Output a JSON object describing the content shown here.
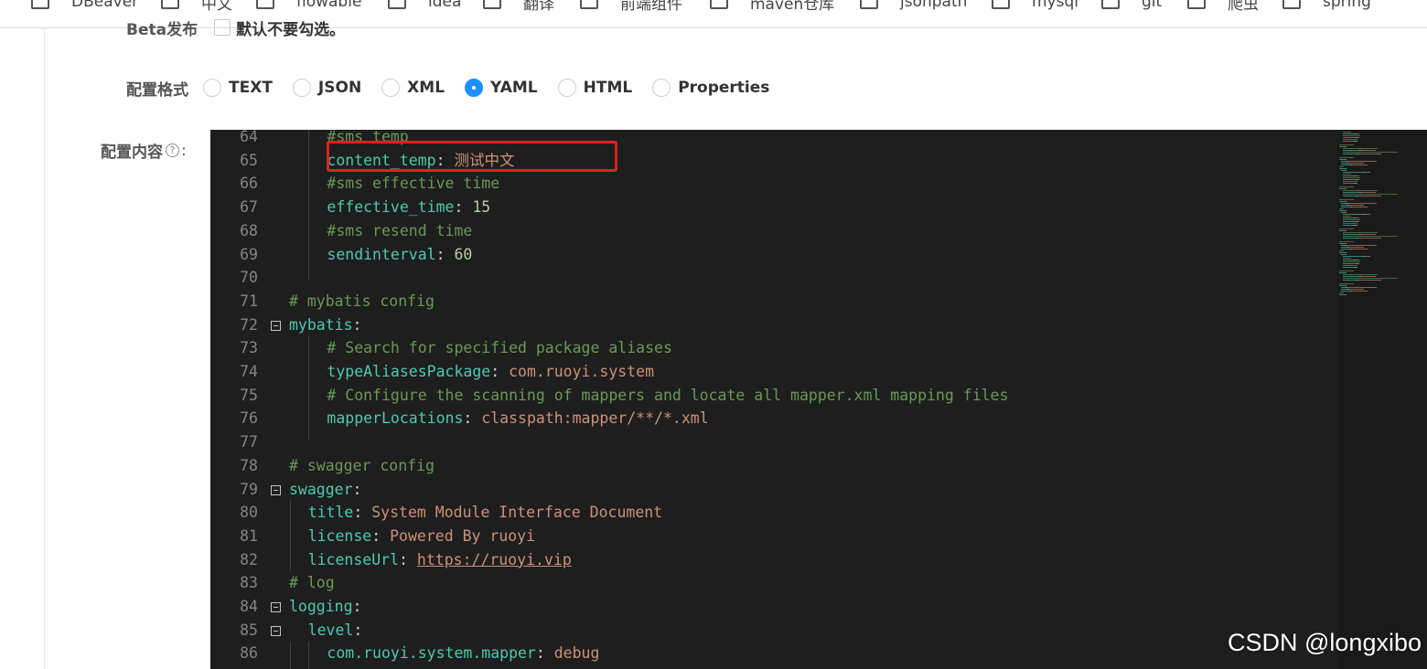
{
  "bookmarks": [
    "DBeaver",
    "中文",
    "flowable",
    "idea",
    "翻译",
    "前端组件",
    "maven仓库",
    "jsonpath",
    "mysql",
    "git",
    "爬虫",
    "spring"
  ],
  "beta": {
    "label": "Beta发布",
    "checkbox_text": "默认不要勾选。"
  },
  "format": {
    "label": "配置格式",
    "options": [
      "TEXT",
      "JSON",
      "XML",
      "YAML",
      "HTML",
      "Properties"
    ],
    "selected": "YAML"
  },
  "content": {
    "label": "配置内容",
    "help": "?",
    "colon": ":"
  },
  "editor": {
    "lines": [
      {
        "no": "64",
        "indent": 2,
        "parts": [
          {
            "t": "#sms temp",
            "c": "c"
          }
        ]
      },
      {
        "no": "65",
        "indent": 2,
        "parts": [
          {
            "t": "content_temp",
            "c": "k"
          },
          {
            "t": ": ",
            "c": "p"
          },
          {
            "t": "测试中文",
            "c": "s"
          }
        ]
      },
      {
        "no": "66",
        "indent": 2,
        "parts": [
          {
            "t": "#sms effective time",
            "c": "c"
          }
        ]
      },
      {
        "no": "67",
        "indent": 2,
        "parts": [
          {
            "t": "effective_time",
            "c": "k"
          },
          {
            "t": ": ",
            "c": "p"
          },
          {
            "t": "15",
            "c": "n"
          }
        ]
      },
      {
        "no": "68",
        "indent": 2,
        "parts": [
          {
            "t": "#sms resend time",
            "c": "c"
          }
        ]
      },
      {
        "no": "69",
        "indent": 2,
        "parts": [
          {
            "t": "sendinterval",
            "c": "k"
          },
          {
            "t": ": ",
            "c": "p"
          },
          {
            "t": "60",
            "c": "n"
          }
        ]
      },
      {
        "no": "70",
        "indent": 0,
        "parts": []
      },
      {
        "no": "71",
        "indent": 0,
        "parts": [
          {
            "t": "# mybatis config",
            "c": "c"
          }
        ]
      },
      {
        "no": "72",
        "indent": 0,
        "fold": true,
        "parts": [
          {
            "t": "mybatis",
            "c": "k"
          },
          {
            "t": ":",
            "c": "p"
          }
        ]
      },
      {
        "no": "73",
        "indent": 2,
        "parts": [
          {
            "t": "# Search for specified package aliases",
            "c": "c"
          }
        ]
      },
      {
        "no": "74",
        "indent": 2,
        "parts": [
          {
            "t": "typeAliasesPackage",
            "c": "k"
          },
          {
            "t": ": ",
            "c": "p"
          },
          {
            "t": "com.ruoyi.system",
            "c": "s"
          }
        ]
      },
      {
        "no": "75",
        "indent": 2,
        "parts": [
          {
            "t": "# Configure the scanning of mappers and locate all mapper.xml mapping files",
            "c": "c"
          }
        ]
      },
      {
        "no": "76",
        "indent": 2,
        "parts": [
          {
            "t": "mapperLocations",
            "c": "k"
          },
          {
            "t": ": ",
            "c": "p"
          },
          {
            "t": "classpath:mapper/**/*.xml",
            "c": "s"
          }
        ]
      },
      {
        "no": "77",
        "indent": 0,
        "parts": []
      },
      {
        "no": "78",
        "indent": 0,
        "parts": [
          {
            "t": "# swagger config",
            "c": "c"
          }
        ]
      },
      {
        "no": "79",
        "indent": 0,
        "fold": true,
        "parts": [
          {
            "t": "swagger",
            "c": "k"
          },
          {
            "t": ":",
            "c": "p"
          }
        ]
      },
      {
        "no": "80",
        "indent": 1,
        "parts": [
          {
            "t": "title",
            "c": "k"
          },
          {
            "t": ": ",
            "c": "p"
          },
          {
            "t": "System Module Interface Document",
            "c": "s"
          }
        ]
      },
      {
        "no": "81",
        "indent": 1,
        "parts": [
          {
            "t": "license",
            "c": "k"
          },
          {
            "t": ": ",
            "c": "p"
          },
          {
            "t": "Powered By ruoyi",
            "c": "s"
          }
        ]
      },
      {
        "no": "82",
        "indent": 1,
        "parts": [
          {
            "t": "licenseUrl",
            "c": "k"
          },
          {
            "t": ": ",
            "c": "p"
          },
          {
            "t": "https://ruoyi.vip",
            "c": "u"
          }
        ]
      },
      {
        "no": "83",
        "indent": 0,
        "parts": [
          {
            "t": "# log",
            "c": "c"
          }
        ]
      },
      {
        "no": "84",
        "indent": 0,
        "fold": true,
        "parts": [
          {
            "t": "logging",
            "c": "k"
          },
          {
            "t": ":",
            "c": "p"
          }
        ]
      },
      {
        "no": "85",
        "indent": 1,
        "fold": true,
        "parts": [
          {
            "t": "level",
            "c": "k"
          },
          {
            "t": ":",
            "c": "p"
          }
        ]
      },
      {
        "no": "86",
        "indent": 2,
        "parts": [
          {
            "t": "com.ruoyi.system.mapper",
            "c": "k"
          },
          {
            "t": ": ",
            "c": "p"
          },
          {
            "t": "debug",
            "c": "s"
          }
        ]
      }
    ]
  },
  "watermark": "CSDN @longxibo"
}
